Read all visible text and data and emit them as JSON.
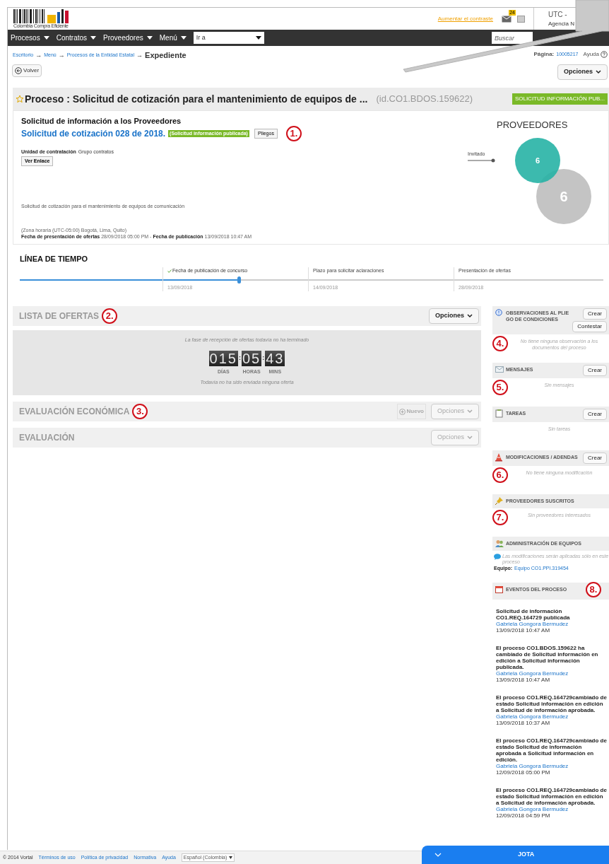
{
  "header": {
    "logo_caption": "Colombia Compra Eficiente",
    "contrast_link": "Aumentar el contraste",
    "mail_badge": "24",
    "utc": "UTC -",
    "agency": "Agencia N"
  },
  "nav": {
    "items": [
      "Procesos",
      "Contratos",
      "Proveedores",
      "Menú"
    ],
    "goto": "Ir a",
    "search_placeholder": "Buscar"
  },
  "breadcrumb": {
    "items": [
      "Escritorio",
      "Menú",
      "Procesos de la Entidad Estatal"
    ],
    "separator": "→",
    "current": "Expediente"
  },
  "page_info": {
    "label": "Página:",
    "number": "10005217",
    "help": "Ayuda"
  },
  "toolbar": {
    "back": "Volver",
    "options": "Opciones"
  },
  "process": {
    "title": "Proceso : Solicitud de cotización para el mantenimiento de equipos de ...",
    "id": "(id.CO1.BDOS.159622)",
    "status": "SOLICITUD INFORMACIÓN PUB..."
  },
  "details": {
    "heading": "Solicitud de información a los Proveedores",
    "name": "Solicitud de cotización 028 de 2018.",
    "status_tag": "(Solicitud información publicada)",
    "pliegos": "Pliegos",
    "marker": "1.",
    "unit_label": "Unidad de contratación",
    "unit": "Grupo contratos",
    "link_button": "Ver Enlace",
    "description": "Solicitud de cotización para el mantenimiento de equipos de comunicación",
    "timezone": "(Zona horaria (UTC-05:00) Bogotá, Lima, Quito)",
    "dates": "**Fecha de presentación de ofertas** 28/09/2018 05:00 PM - **Fecha de publicación** 13/09/2018 10:47 AM"
  },
  "providers": {
    "title": "PROVEEDORES",
    "label": "Invitado",
    "invited": "6",
    "total": "6"
  },
  "timeline": {
    "title": "LÍNEA DE TIEMPO",
    "level": 0.375,
    "stages": [
      {
        "label": "Fecha de publicación de concurso",
        "date": "13/09/2018",
        "done": true
      },
      {
        "label": "Plazo para solicitar aclaraciones",
        "date": "14/09/2018",
        "done": false
      },
      {
        "label": "Presentación de ofertas",
        "date": "28/09/2018",
        "done": false
      }
    ]
  },
  "sections": [
    {
      "kind": "offers",
      "title": "LISTA DE OFERTAS",
      "marker": "2.",
      "options": "Opciones",
      "enabled": true
    },
    {
      "kind": "plain",
      "title": "EVALUACIÓN ECONÓMICA",
      "marker": "3.",
      "new_button": "Nuevo",
      "options": "Opciones",
      "enabled": false
    },
    {
      "kind": "plain",
      "title": "EVALUACIÓN",
      "options": "Opciones",
      "enabled": false
    }
  ],
  "countdown": {
    "note": "La fase de recepción de ofertas todavía no ha terminado",
    "groups": [
      {
        "value": "015",
        "label": "DÍAS"
      },
      {
        "value": "05",
        "label": "HORAS"
      },
      {
        "value": "43",
        "label": "MINS"
      }
    ],
    "colon": ":",
    "empty": "Todavía no ha sido enviada ninguna oferta"
  },
  "sidebar": [
    {
      "kind": "observations",
      "title": "OBSERVACIONES AL PLIEGO DE CONDICIONES",
      "buttons": [
        "Crear",
        "Contestar"
      ],
      "empty": "No tiene ninguna observación a los documentos del proceso",
      "marker": "4."
    },
    {
      "kind": "messages",
      "title": "MENSAJES",
      "buttons": [
        "Crear"
      ],
      "empty": "Sin mensajes",
      "marker": "5."
    },
    {
      "kind": "tasks",
      "title": "TAREAS",
      "buttons": [
        "Crear"
      ],
      "empty": "Sin tareas"
    },
    {
      "kind": "modifications",
      "title": "MODIFICACIONES / ADENDAS",
      "buttons": [
        "Crear"
      ],
      "empty": "No tiene ninguna modificación",
      "marker": "6."
    },
    {
      "kind": "subscribers",
      "title": "PROVEEDORES SUSCRITOS",
      "empty": "Sin proveedores interesados",
      "marker": "7."
    },
    {
      "kind": "teams",
      "title": "ADMINISTRACIÓN DE EQUIPOS",
      "note": "Las modificaciones serán aplicadas sólo en este proceso",
      "team_label": "Equipo:",
      "team_link": "Equipo CO1.PPI.319454"
    },
    {
      "kind": "events",
      "title": "EVENTOS DEL PROCESO",
      "marker": "8.",
      "events": [
        {
          "text": "Solicitud de información CO1.REQ.164729 publicada",
          "author": "Gabriela Gongora Bermudez",
          "date": "13/09/2018 10:47 AM"
        },
        {
          "text": "El proceso CO1.BDOS.159622 ha cambiado de Solicitud información en edición a Solicitud información publicada.",
          "author": "Gabriela Gongora Bermudez",
          "date": "13/09/2018 10:47 AM"
        },
        {
          "text": "El proceso CO1.REQ.164729cambiado de estado Solicitud información en edición a Solicitud de información aprobada.",
          "author": "Gabriela Gongora Bermudez",
          "date": "13/09/2018 10:37 AM"
        },
        {
          "text": "El proceso CO1.REQ.164729cambiado de estado Solicitud de información aprobada a Solicitud información en edición.",
          "author": "Gabriela Gongora Bermudez",
          "date": "12/09/2018 05:00 PM"
        },
        {
          "text": "El proceso CO1.REQ.164729cambiado de estado Solicitud información en edición a Solicitud de información aprobada.",
          "author": "Gabriela Gongora Bermudez",
          "date": "12/09/2018 04:59 PM"
        }
      ]
    }
  ],
  "footer": {
    "copyright": "© 2014 Vortal",
    "links": [
      "Términos de uso",
      "Política de privacidad",
      "Normativa",
      "Ayuda"
    ],
    "language": "Español (Colombia)"
  },
  "chat": {
    "title": "JOTA"
  }
}
